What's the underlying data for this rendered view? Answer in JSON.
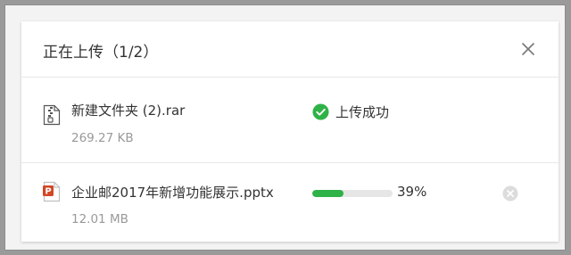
{
  "dialog": {
    "title": "正在上传（1/2）",
    "close_icon": "close-icon"
  },
  "files": [
    {
      "name": "新建文件夹 (2).rar",
      "size": "269.27 KB",
      "icon": "archive-file-icon",
      "status_text": "上传成功",
      "status_icon": "check-circle-icon"
    },
    {
      "name": "企业邮2017年新增功能展示.pptx",
      "size": "12.01 MB",
      "icon": "ppt-file-icon",
      "progress_text": "39%",
      "progress": 0.39,
      "cancel_icon": "cancel-icon"
    }
  ],
  "colors": {
    "success": "#2fb247",
    "ppt_brand": "#d24726",
    "progress_track": "#e6e6e6"
  }
}
